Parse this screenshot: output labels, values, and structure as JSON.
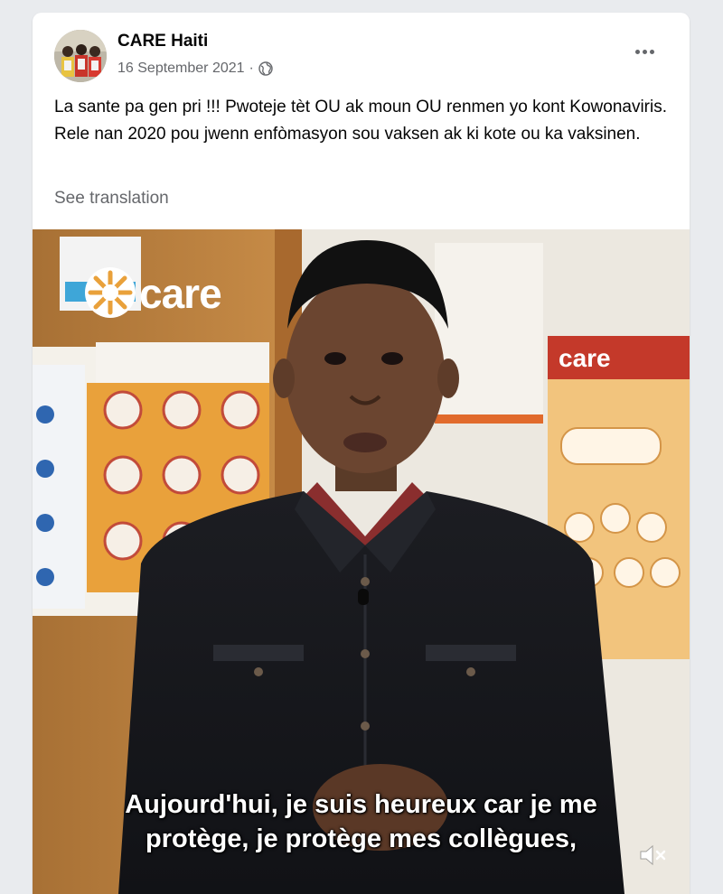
{
  "post": {
    "author": "CARE Haiti",
    "date": "16 September 2021",
    "separator": "·",
    "audience_icon": "globe-icon",
    "more_icon": "more-options-icon",
    "text": "La sante pa gen pri !!! Pwoteje tèt OU ak moun OU renmen yo kont Kowonaviris. Rele nan 2020 pou jwenn enfòmasyon sou vaksen ak ki kote ou ka vaksinen.",
    "see_translation": "See translation"
  },
  "video": {
    "logo_text": "care",
    "poster_logo_text": "care",
    "subtitle_line1": "Aujourd'hui, je suis heureux car je me",
    "subtitle_line2": "protège, je protège mes collègues,",
    "mute_icon": "muted-speaker-icon"
  },
  "colors": {
    "text_primary": "#050505",
    "text_secondary": "#65676b",
    "care_orange": "#e7a33e",
    "care_red": "#c4392a"
  }
}
